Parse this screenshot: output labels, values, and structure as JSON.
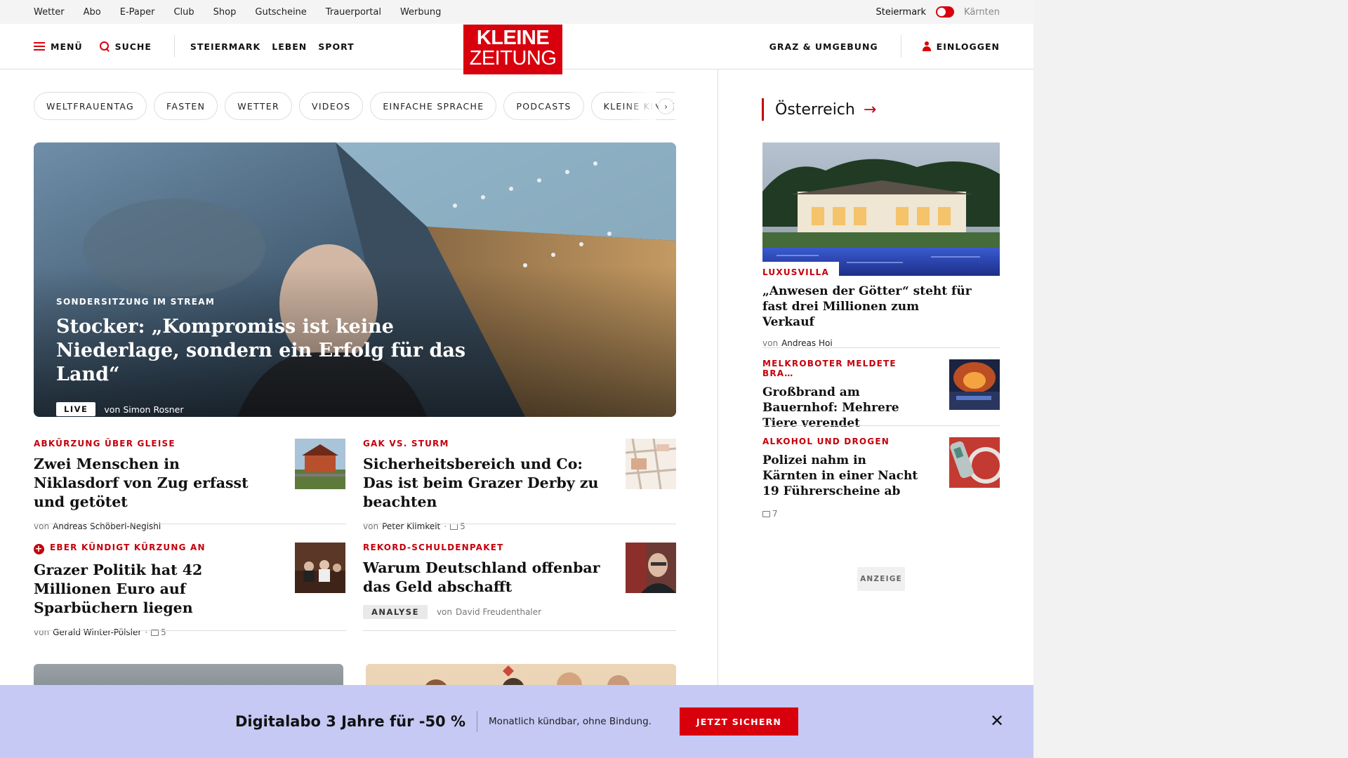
{
  "utility_bar": {
    "links": [
      "Wetter",
      "Abo",
      "E-Paper",
      "Club",
      "Shop",
      "Gutscheine",
      "Trauerportal",
      "Werbung"
    ],
    "region_active": "Steiermark",
    "region_other": "Kärnten"
  },
  "header": {
    "menu_label": "MENÜ",
    "search_label": "SUCHE",
    "nav": [
      "STEIERMARK",
      "LEBEN",
      "SPORT"
    ],
    "logo_line1": "KLEINE",
    "logo_line2": "ZEITUNG",
    "region_link": "GRAZ & UMGEBUNG",
    "login_label": "EINLOGGEN"
  },
  "tags": [
    "WELTFRAUENTAG",
    "FASTEN",
    "WETTER",
    "VIDEOS",
    "EINFACHE SPRACHE",
    "PODCASTS",
    "KLEINE KINDERZEITUNG"
  ],
  "hero": {
    "kicker": "SONDERSITZUNG IM STREAM",
    "title": "Stocker: „Kompromiss ist keine Niederlage, sondern ein Erfolg für das Land“",
    "badge": "LIVE",
    "author_prefix": "von",
    "author": "Simon Rosner"
  },
  "articles": [
    {
      "kicker": "ABKÜRZUNG ÜBER GLEISE",
      "title": "Zwei Menschen in Niklasdorf von Zug erfasst und getötet",
      "author_prefix": "von",
      "author": "Andreas Schöberl-Negishi"
    },
    {
      "kicker": "GAK VS. STURM",
      "title": "Sicherheitsbereich und Co: Das ist beim Grazer Derby zu beachten",
      "author_prefix": "von",
      "author": "Peter Klimkeit",
      "comments": "5"
    },
    {
      "kicker": "EBER KÜNDIGT KÜRZUNG AN",
      "title": "Grazer Politik hat 42 Millionen Euro auf Sparbüchern liegen",
      "author_prefix": "von",
      "author": "Gerald Winter-Pölsler",
      "comments": "5"
    },
    {
      "kicker": "REKORD-SCHULDENPAKET",
      "title": "Warum Deutschland offenbar das Geld abschafft",
      "badge": "ANALYSE",
      "author_prefix": "von",
      "author": "David Freudenthaler"
    }
  ],
  "sidebar": {
    "section_title": "Österreich",
    "lead": {
      "kicker": "LUXUSVILLA",
      "title": "„Anwesen der Götter“ steht für fast drei Millionen zum Verkauf",
      "author_prefix": "von",
      "author": "Andreas Hoi"
    },
    "items": [
      {
        "kicker": "MELKROBOTER MELDETE BRA…",
        "title": "Großbrand am Bauernhof: Mehrere Tiere verendet"
      },
      {
        "kicker": "ALKOHOL UND DROGEN",
        "title": "Polizei nahm in Kärnten in einer Nacht 19 Führerscheine ab",
        "comments": "7"
      }
    ],
    "ad_label": "ANZEIGE"
  },
  "banner": {
    "title": "Digitalabo 3 Jahre für -50 %",
    "subtitle": "Monatlich kündbar, ohne Bindung.",
    "button": "JETZT SICHERN"
  },
  "colors": {
    "brand_red": "#d9000d",
    "kicker_red": "#c4000b",
    "banner_bg": "#c5c9f4"
  },
  "icons": [
    "menu-icon",
    "search-icon",
    "user-icon",
    "chevron-right-icon",
    "arrow-right-icon",
    "comment-icon",
    "plus-circle-icon",
    "close-icon"
  ]
}
